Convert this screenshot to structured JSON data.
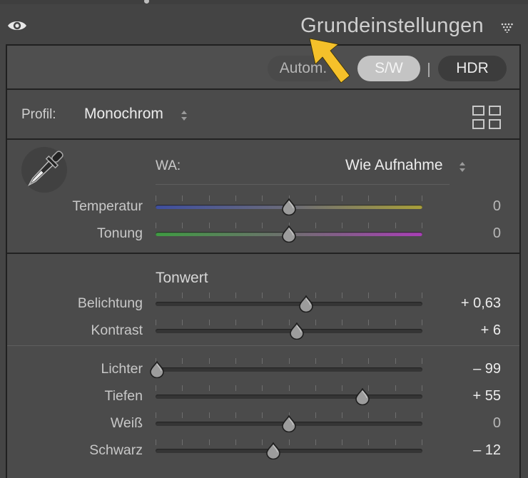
{
  "panel": {
    "title": "Grundeinstellungen"
  },
  "treatment": {
    "auto_label": "Autom.",
    "bw_label": "S/W",
    "hdr_label": "HDR"
  },
  "profile": {
    "label": "Profil:",
    "value": "Monochrom"
  },
  "white_balance": {
    "label": "WA:",
    "value": "Wie Aufnahme",
    "sliders": [
      {
        "label": "Temperatur",
        "value": "0",
        "position": 0.5
      },
      {
        "label": "Tonung",
        "value": "0",
        "position": 0.5
      }
    ]
  },
  "tone": {
    "title": "Tonwert",
    "sliders": [
      {
        "label": "Belichtung",
        "value": "+ 0,63",
        "position": 0.563
      },
      {
        "label": "Kontrast",
        "value": "+ 6",
        "position": 0.53
      }
    ],
    "presence_sliders": [
      {
        "label": "Lichter",
        "value": "– 99",
        "position": 0.005
      },
      {
        "label": "Tiefen",
        "value": "+ 55",
        "position": 0.775
      },
      {
        "label": "Weiß",
        "value": "0",
        "position": 0.5
      },
      {
        "label": "Schwarz",
        "value": "– 12",
        "position": 0.44
      }
    ]
  },
  "colors": {
    "arrow": "#f5c12a",
    "bw_active": "#c4c4c4"
  }
}
